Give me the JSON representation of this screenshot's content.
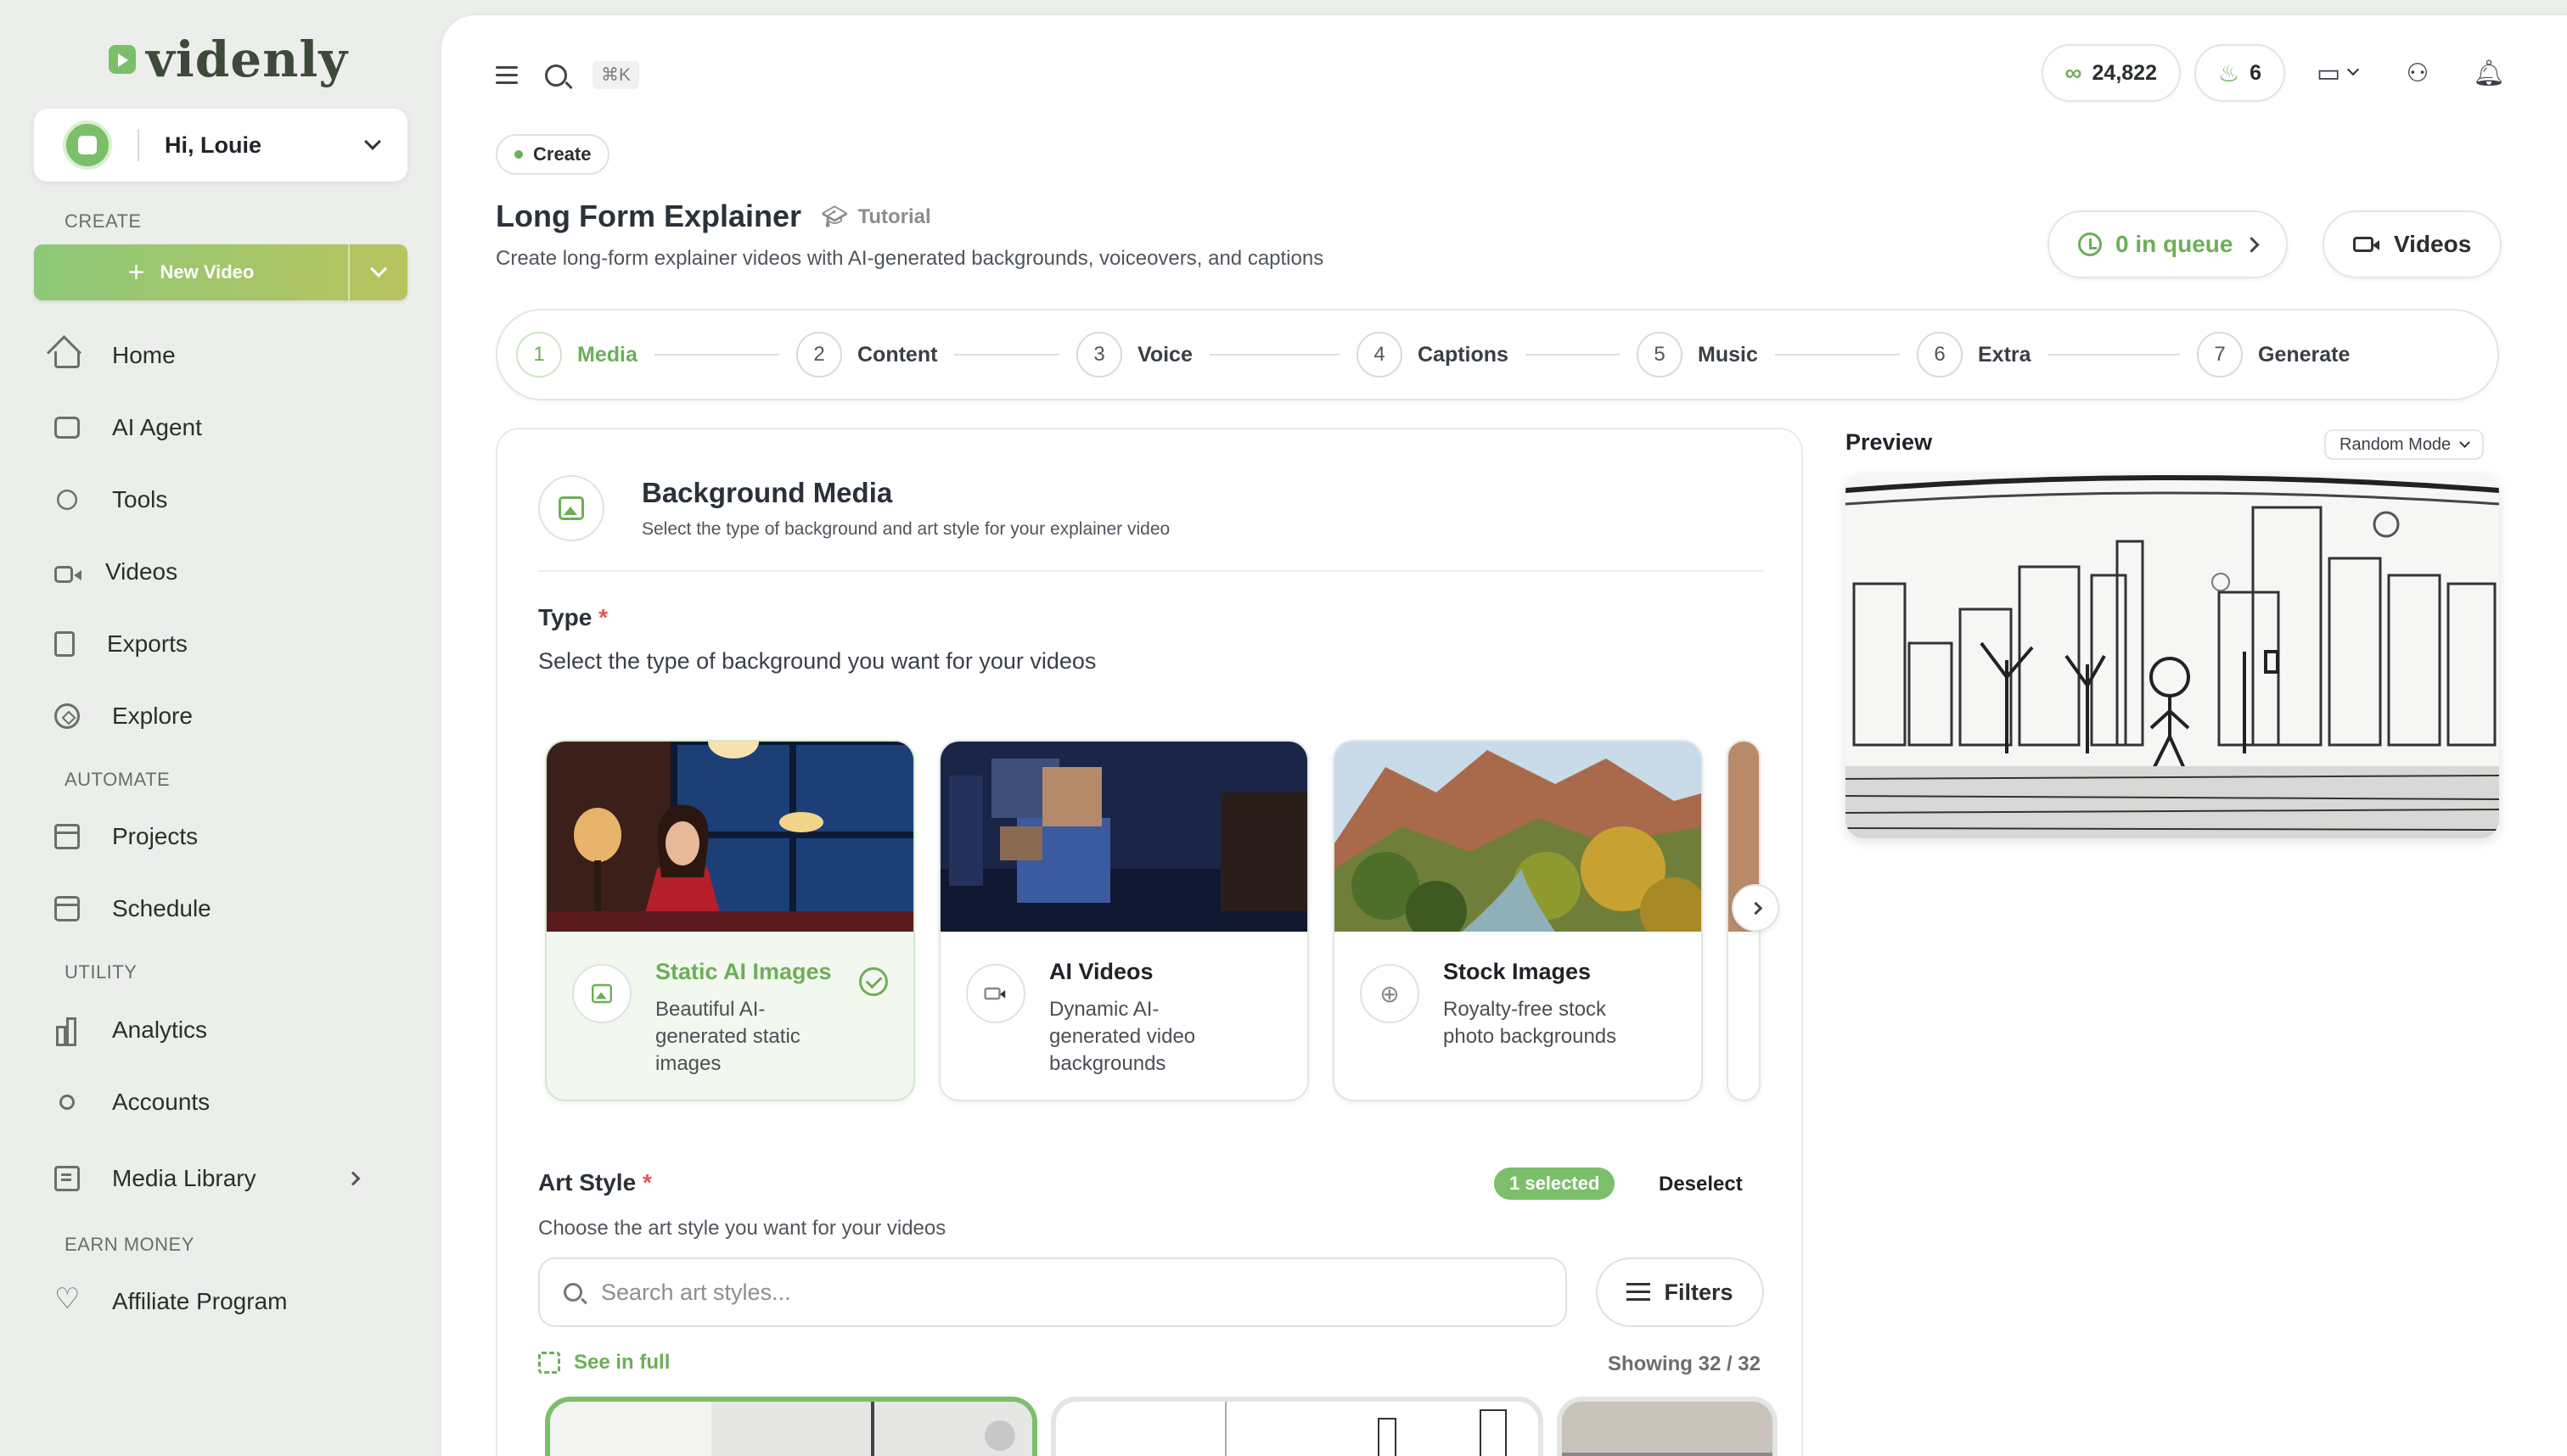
{
  "brand": {
    "name": "videnly",
    "accent": "#6dae5a"
  },
  "user": {
    "greeting": "Hi, Louie"
  },
  "sidebar": {
    "sections": {
      "create": "CREATE",
      "automate": "AUTOMATE",
      "utility": "UTILITY",
      "earn": "EARN MONEY"
    },
    "new_video_label": "New Video",
    "items": [
      {
        "label": "Home",
        "icon": "home-icon"
      },
      {
        "label": "AI Agent",
        "icon": "chat-icon"
      },
      {
        "label": "Tools",
        "icon": "tools-icon"
      },
      {
        "label": "Videos",
        "icon": "video-icon"
      },
      {
        "label": "Exports",
        "icon": "file-icon"
      },
      {
        "label": "Explore",
        "icon": "compass-icon"
      },
      {
        "label": "Projects",
        "icon": "archive-icon"
      },
      {
        "label": "Schedule",
        "icon": "calendar-icon"
      },
      {
        "label": "Analytics",
        "icon": "bar-chart-icon"
      },
      {
        "label": "Accounts",
        "icon": "plug-icon"
      },
      {
        "label": "Media Library",
        "icon": "library-icon"
      },
      {
        "label": "Affiliate Program",
        "icon": "heart-icon"
      }
    ]
  },
  "topbar": {
    "shortcut": "⌘K",
    "credits": "24,822",
    "streak": "6"
  },
  "page": {
    "badge": "Create",
    "title": "Long Form Explainer",
    "tutorial": "Tutorial",
    "subtitle": "Create long-form explainer videos with AI-generated backgrounds, voiceovers, and captions",
    "queue": "0 in queue",
    "videos": "Videos"
  },
  "steps": [
    {
      "num": "1",
      "label": "Media"
    },
    {
      "num": "2",
      "label": "Content"
    },
    {
      "num": "3",
      "label": "Voice"
    },
    {
      "num": "4",
      "label": "Captions"
    },
    {
      "num": "5",
      "label": "Music"
    },
    {
      "num": "6",
      "label": "Extra"
    },
    {
      "num": "7",
      "label": "Generate"
    }
  ],
  "background_media": {
    "title": "Background Media",
    "subtitle": "Select the type of background and art style for your explainer video",
    "type_label": "Type",
    "required": "*",
    "type_sub": "Select the type of background you want for your videos",
    "types": [
      {
        "title": "Static AI Images",
        "desc": "Beautiful AI-generated static images"
      },
      {
        "title": "AI Videos",
        "desc": "Dynamic AI-generated video backgrounds"
      },
      {
        "title": "Stock Images",
        "desc": "Royalty-free stock photo backgrounds"
      }
    ],
    "art_label": "Art Style",
    "art_sub": "Choose the art style you want for your videos",
    "selected_count": "1 selected",
    "deselect": "Deselect",
    "search_placeholder": "Search art styles...",
    "filters": "Filters",
    "see_full": "See in full",
    "showing": "Showing 32 / 32"
  },
  "preview": {
    "label": "Preview",
    "mode": "Random Mode"
  }
}
